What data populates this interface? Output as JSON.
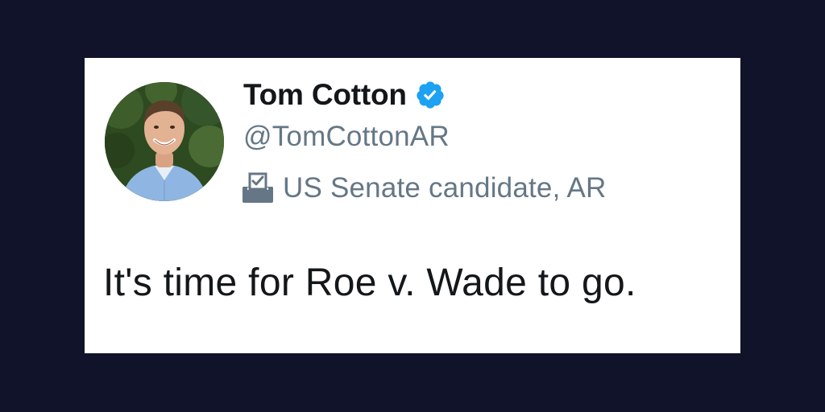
{
  "tweet": {
    "display_name": "Tom Cotton",
    "verified": true,
    "handle": "@TomCottonAR",
    "label": "US Senate candidate, AR",
    "text": "It's time for Roe v. Wade to go."
  },
  "icons": {
    "verified": "verified-badge-icon",
    "label": "ballot-box-icon",
    "avatar": "profile-photo"
  },
  "colors": {
    "background": "#11132a",
    "card": "#ffffff",
    "name_text": "#14171a",
    "secondary_text": "#657786",
    "verified_blue": "#1da1f2"
  }
}
